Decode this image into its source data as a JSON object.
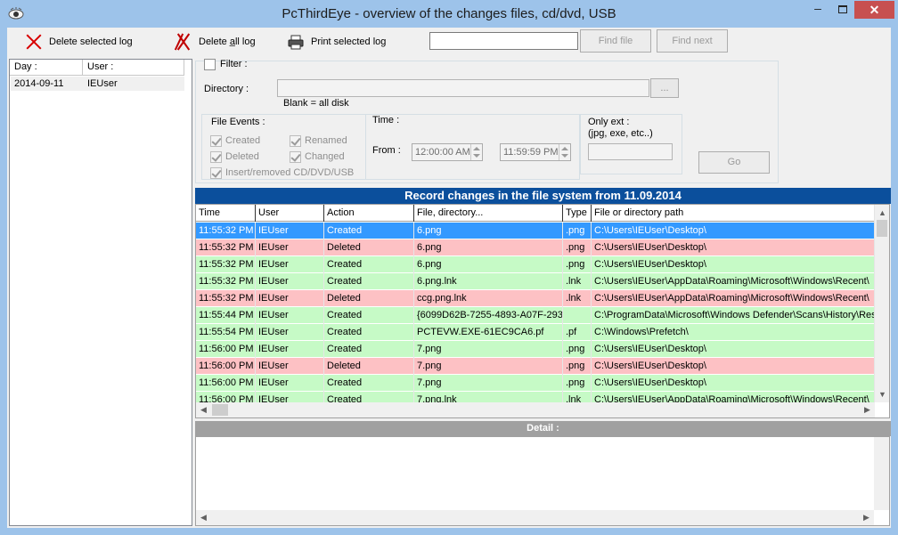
{
  "window": {
    "title": "PcThirdEye - overview of the changes  files, cd/dvd, USB",
    "minimize_glyph": "–",
    "close_glyph": "✕"
  },
  "toolbar": {
    "delete_selected": "Delete selected log",
    "delete_all": "Delete a̲ll log",
    "print_selected": "Print selected log",
    "find_value": "",
    "find_file": "Find file",
    "find_next": "Find next"
  },
  "days": {
    "headers": [
      "Day  :",
      "User  :"
    ],
    "rows": [
      {
        "day": "2014-09-11",
        "user": "IEUser"
      }
    ]
  },
  "filter": {
    "filter_label": "Filter :",
    "directory_label": "Directory  :",
    "directory_value": "",
    "browse_label": "...",
    "blank_hint": "Blank = all disk",
    "file_events_label": "File Events  :",
    "events": [
      "Created",
      "Renamed",
      "Deleted",
      "Changed",
      "Insert/removed CD/DVD/USB"
    ],
    "time_label": "Time  :",
    "from_label": "From  :",
    "from_value": "12:00:00 AM",
    "to_value": "11:59:59 PM",
    "only_ext_label": "Only ext  :",
    "only_ext_hint": "(jpg, exe, etc..)",
    "only_ext_value": "",
    "go_label": "Go"
  },
  "records": {
    "title": "Record changes in the file system from 11.09.2014",
    "columns": [
      "Time",
      "User",
      "Action",
      "File, directory...",
      "Type",
      "File or directory path"
    ],
    "rows": [
      {
        "time": "11:55:32 PM",
        "user": "IEUser",
        "action": "Created",
        "file": "6.png",
        "type": ".png",
        "path": "C:\\Users\\IEUser\\Desktop\\",
        "kind": "sel"
      },
      {
        "time": "11:55:32 PM",
        "user": "IEUser",
        "action": "Deleted",
        "file": "6.png",
        "type": ".png",
        "path": "C:\\Users\\IEUser\\Desktop\\",
        "kind": "deleted"
      },
      {
        "time": "11:55:32 PM",
        "user": "IEUser",
        "action": "Created",
        "file": "6.png",
        "type": ".png",
        "path": "C:\\Users\\IEUser\\Desktop\\",
        "kind": "created"
      },
      {
        "time": "11:55:32 PM",
        "user": "IEUser",
        "action": "Created",
        "file": "6.png.lnk",
        "type": ".lnk",
        "path": "C:\\Users\\IEUser\\AppData\\Roaming\\Microsoft\\Windows\\Recent\\",
        "kind": "created"
      },
      {
        "time": "11:55:32 PM",
        "user": "IEUser",
        "action": "Deleted",
        "file": "ccg.png.lnk",
        "type": ".lnk",
        "path": "C:\\Users\\IEUser\\AppData\\Roaming\\Microsoft\\Windows\\Recent\\",
        "kind": "deleted"
      },
      {
        "time": "11:55:44 PM",
        "user": "IEUser",
        "action": "Created",
        "file": "{6099D62B-7255-4893-A07F-293",
        "type": "",
        "path": "C:\\ProgramData\\Microsoft\\Windows Defender\\Scans\\History\\Res",
        "kind": "created"
      },
      {
        "time": "11:55:54 PM",
        "user": "IEUser",
        "action": "Created",
        "file": "PCTEVW.EXE-61EC9CA6.pf",
        "type": ".pf",
        "path": "C:\\Windows\\Prefetch\\",
        "kind": "created"
      },
      {
        "time": "11:56:00 PM",
        "user": "IEUser",
        "action": "Created",
        "file": "7.png",
        "type": ".png",
        "path": "C:\\Users\\IEUser\\Desktop\\",
        "kind": "created"
      },
      {
        "time": "11:56:00 PM",
        "user": "IEUser",
        "action": "Deleted",
        "file": "7.png",
        "type": ".png",
        "path": "C:\\Users\\IEUser\\Desktop\\",
        "kind": "deleted"
      },
      {
        "time": "11:56:00 PM",
        "user": "IEUser",
        "action": "Created",
        "file": "7.png",
        "type": ".png",
        "path": "C:\\Users\\IEUser\\Desktop\\",
        "kind": "created"
      },
      {
        "time": "11:56:00 PM",
        "user": "IEUser",
        "action": "Created",
        "file": "7.png.lnk",
        "type": ".lnk",
        "path": "C:\\Users\\IEUser\\AppData\\Roaming\\Microsoft\\Windows\\Recent\\",
        "kind": "created"
      }
    ]
  },
  "detail": {
    "title": "Detail :",
    "text": ""
  },
  "colors": {
    "created_row": "#c6fac6",
    "deleted_row": "#fdc1c4",
    "selected_row": "#3399ff",
    "records_header": "#0b4f9c"
  }
}
